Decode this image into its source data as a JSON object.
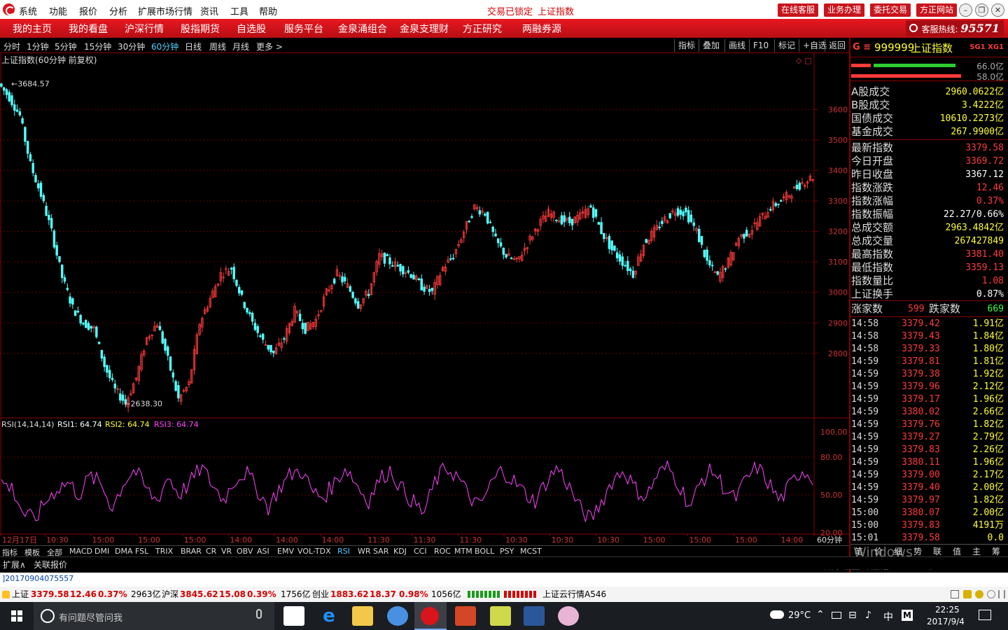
{
  "titlebar": {
    "menu": [
      "系统",
      "功能",
      "报价",
      "分析",
      "扩展市场行情",
      "资讯",
      "工具",
      "帮助"
    ],
    "center_status": "交易已锁定",
    "center_title": "上证指数",
    "buttons": [
      "在线客服",
      "业务办理",
      "委托交易",
      "方正网站"
    ]
  },
  "nav": {
    "items": [
      "我的主页",
      "我的看盘",
      "沪深行情",
      "股指期货",
      "自选股",
      "服务平台",
      "金泉涌组合",
      "金泉支理财",
      "方正研究",
      "两融券源"
    ],
    "hotline_label": "客服热线:",
    "hotline_number": "95571"
  },
  "periods": {
    "items": [
      "分时",
      "1分钟",
      "5分钟",
      "15分钟",
      "30分钟",
      "60分钟",
      "日线",
      "周线",
      "月线",
      "更多 >"
    ],
    "active": "60分钟",
    "tools": [
      "指标",
      "叠加",
      "画线",
      "F10",
      "标记",
      "+自选",
      "返回"
    ]
  },
  "main_chart": {
    "title": "上证指数(60分钟 前复权)",
    "high_label": "3684.57",
    "low_label": "2638.30",
    "price_ticks": [
      "3600",
      "3500",
      "3400",
      "3300",
      "3200",
      "3100",
      "3000",
      "2900",
      "2800"
    ],
    "indicator_label": "RSI(14,14,14)",
    "rsi1": "RSI1: 64.74",
    "rsi2": "RSI2: 64.74",
    "rsi3": "RSI3: 64.74",
    "rsi_ticks": [
      "100.00",
      "80.00",
      "50.00",
      "20.00"
    ],
    "time_labels": [
      "12月17日",
      "10:30",
      "15:00",
      "15:00",
      "15:00",
      "14:00",
      "14:00",
      "14:00",
      "11:30",
      "11:30",
      "11:30",
      "10:30",
      "10:30",
      "10:30",
      "15:00",
      "15:00",
      "15:00",
      "14:00"
    ],
    "period_label": "60分钟"
  },
  "chart_data": {
    "type": "line",
    "title": "上证指数(60分钟 前复权)",
    "series": [
      {
        "name": "K线",
        "values": [
          3684.57,
          3640,
          3580,
          3420,
          3320,
          3200,
          3050,
          2950,
          2900,
          2880,
          2760,
          2680,
          2638.3,
          2720,
          2850,
          2900,
          2780,
          2650,
          2700,
          2900,
          2980,
          3060,
          3080,
          2980,
          2900,
          2840,
          2800,
          2850,
          2940,
          2880,
          2910,
          3000,
          3060,
          3020,
          2960,
          3000,
          3120,
          3100,
          3080,
          3060,
          3020,
          3000,
          3080,
          3120,
          3200,
          3280,
          3260,
          3170,
          3120,
          3100,
          3160,
          3220,
          3260,
          3240,
          3230,
          3250,
          3280,
          3200,
          3140,
          3100,
          3060,
          3160,
          3200,
          3240,
          3270,
          3260,
          3200,
          3100,
          3050,
          3100,
          3180,
          3200,
          3240,
          3280,
          3300,
          3330,
          3360,
          3379.58
        ]
      }
    ],
    "ylim": [
      2600,
      3720
    ],
    "rsi": {
      "name": "RSI",
      "ylim": [
        20,
        100
      ],
      "values": [
        60,
        55,
        35,
        30,
        45,
        55,
        60,
        50,
        65,
        58,
        40,
        60,
        70,
        55,
        45,
        65,
        50,
        60,
        72,
        58,
        46,
        62,
        68,
        55,
        40,
        55,
        66,
        70,
        52,
        48,
        60,
        72,
        58,
        45,
        62,
        70,
        55,
        45,
        35,
        60,
        72,
        65,
        50,
        40,
        58,
        70,
        62,
        52,
        45,
        60,
        72,
        58,
        40,
        30,
        45,
        62,
        70,
        55,
        48,
        66,
        72,
        58,
        40,
        62,
        70,
        56,
        46,
        62,
        72,
        60,
        45,
        58,
        70,
        64
      ]
    }
  },
  "right_panel": {
    "code": "999999",
    "name": "上证指数",
    "badge": "SG1 XG1",
    "bar_top_val": "66.0亿",
    "bar_bottom_val": "58.0亿",
    "turnover": [
      {
        "k": "A股成交",
        "v": "2960.0622亿"
      },
      {
        "k": "B股成交",
        "v": "3.4222亿"
      },
      {
        "k": "国债成交",
        "v": "10610.2273亿"
      },
      {
        "k": "基金成交",
        "v": "267.9900亿"
      }
    ],
    "stats": [
      {
        "k": "最新指数",
        "v": "3379.58",
        "c": "red"
      },
      {
        "k": "今日开盘",
        "v": "3369.72",
        "c": "red"
      },
      {
        "k": "昨日收盘",
        "v": "3367.12",
        "c": ""
      },
      {
        "k": "指数涨跌",
        "v": "12.46",
        "c": "red"
      },
      {
        "k": "指数涨幅",
        "v": "0.37%",
        "c": "red"
      },
      {
        "k": "指数振幅",
        "v": "22.27/0.66%",
        "c": ""
      },
      {
        "k": "总成交额",
        "v": "2963.4842亿",
        "c": "yellow"
      },
      {
        "k": "总成交量",
        "v": "267427849",
        "c": "yellow"
      },
      {
        "k": "最高指数",
        "v": "3381.40",
        "c": "red"
      },
      {
        "k": "最低指数",
        "v": "3359.13",
        "c": "red"
      },
      {
        "k": "指数量比",
        "v": "1.08",
        "c": "red"
      },
      {
        "k": "上证换手",
        "v": "0.87%",
        "c": ""
      }
    ],
    "up_label": "涨家数",
    "up_count": "599",
    "down_label": "跌家数",
    "down_count": "669",
    "ticks": [
      {
        "t": "14:58",
        "p": "3379.42",
        "v": "1.91亿"
      },
      {
        "t": "14:58",
        "p": "3379.43",
        "v": "1.84亿"
      },
      {
        "t": "14:58",
        "p": "3379.33",
        "v": "1.80亿"
      },
      {
        "t": "14:59",
        "p": "3379.81",
        "v": "1.81亿"
      },
      {
        "t": "14:59",
        "p": "3379.38",
        "v": "1.92亿"
      },
      {
        "t": "14:59",
        "p": "3379.96",
        "v": "2.12亿"
      },
      {
        "t": "14:59",
        "p": "3379.17",
        "v": "1.96亿"
      },
      {
        "t": "14:59",
        "p": "3380.02",
        "v": "2.66亿"
      },
      {
        "t": "14:59",
        "p": "3379.76",
        "v": "1.82亿"
      },
      {
        "t": "14:59",
        "p": "3379.27",
        "v": "2.79亿"
      },
      {
        "t": "14:59",
        "p": "3379.83",
        "v": "2.26亿"
      },
      {
        "t": "14:59",
        "p": "3380.11",
        "v": "1.96亿"
      },
      {
        "t": "14:59",
        "p": "3379.00",
        "v": "2.17亿"
      },
      {
        "t": "14:59",
        "p": "3379.40",
        "v": "2.00亿"
      },
      {
        "t": "14:59",
        "p": "3379.97",
        "v": "1.82亿"
      },
      {
        "t": "15:00",
        "p": "3380.07",
        "v": "2.00亿"
      },
      {
        "t": "15:00",
        "p": "3379.83",
        "v": "4191万"
      },
      {
        "t": "15:01",
        "p": "3379.58",
        "v": "0.0"
      }
    ],
    "bottom_tabs": [
      "笔",
      "价",
      "细",
      "势",
      "联",
      "值",
      "主",
      "筹"
    ],
    "watermark1": "激活 Windows",
    "watermark2": "转到\"设置\"以激活 Windows。"
  },
  "indicator_tabs": [
    "指标",
    "模板",
    "全部",
    "MACD",
    "DMI",
    "DMA",
    "FSL",
    "TRIX",
    "BRAR",
    "CR",
    "VR",
    "OBV",
    "ASI",
    "EMV",
    "VOL-TDX",
    "RSI",
    "WR",
    "SAR",
    "KDJ",
    "CCI",
    "ROC",
    "MTM",
    "BOLL",
    "PSY",
    "MCST"
  ],
  "indicator_active": "RSI",
  "sub_tabs": [
    "扩展∧",
    "关联报价"
  ],
  "code_line": "]20170904075557",
  "status": {
    "sh_label": "上证",
    "sh_price": "3379.58",
    "sh_chg": "12.46",
    "sh_pct": "0.37%",
    "sh_amt": "2963亿",
    "sz_label": "沪深",
    "sz_price": "3845.62",
    "sz_chg": "15.08",
    "sz_pct": "0.39%",
    "sz_amt": "1756亿",
    "cy_label": "创业",
    "cy_price": "1883.62",
    "cy_chg": "18.37",
    "cy_pct": "0.98%",
    "cy_amt": "1056亿",
    "cloud": "上证云行情A546"
  },
  "taskbar": {
    "search_placeholder": "有问题尽管问我",
    "temp": "29°C",
    "ime": "中",
    "time": "22:25",
    "date": "2017/9/4"
  }
}
